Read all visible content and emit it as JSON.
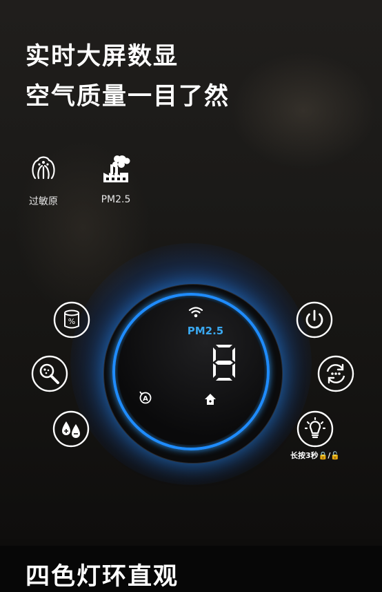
{
  "headline": {
    "line1": "实时大屏数显",
    "line2": "空气质量一目了然",
    "line3": "四色灯环直观"
  },
  "features": [
    {
      "icon": "allergen-icon",
      "label": "过敏原"
    },
    {
      "icon": "factory-smoke-icon",
      "label": "PM2.5"
    }
  ],
  "display": {
    "mode_label": "PM2.5",
    "reading": "8",
    "ring_color": "#1f8cff",
    "label_color": "#3aa8f0",
    "icons": [
      "wifi-icon",
      "auto-mode-icon",
      "home-icon"
    ]
  },
  "buttons": {
    "left": [
      "filter-icon",
      "search-icon",
      "humidity-icon"
    ],
    "right": [
      "power-icon",
      "cycle-icon",
      "light-bulb-icon"
    ],
    "lock_hint": "长按3秒🔒/🔓"
  }
}
